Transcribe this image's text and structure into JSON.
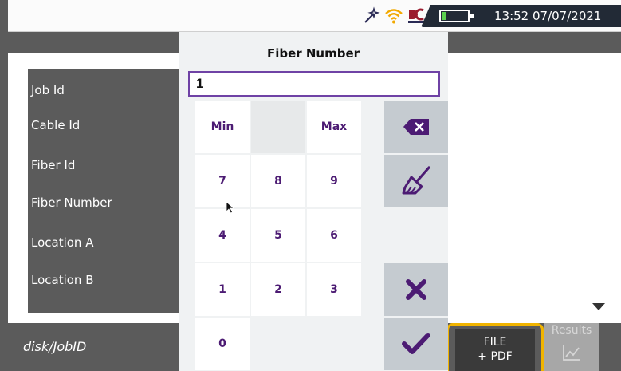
{
  "status_bar": {
    "icons": [
      "magic-wand-icon",
      "wifi-icon",
      "dc-power-icon",
      "battery-icon"
    ],
    "battery_level": 0.2,
    "clock": "13:52 07/07/2021"
  },
  "form": {
    "fields": [
      {
        "label": "Job Id"
      },
      {
        "label": "Cable Id"
      },
      {
        "label": "Fiber Id"
      },
      {
        "label": "Fiber Number"
      },
      {
        "label": "Location A"
      },
      {
        "label": "Location B"
      }
    ]
  },
  "dialog": {
    "title": "Fiber Number",
    "input_value": "1",
    "keys": {
      "min": "Min",
      "max": "Max",
      "k7": "7",
      "k8": "8",
      "k9": "9",
      "k4": "4",
      "k5": "5",
      "k6": "6",
      "k1": "1",
      "k2": "2",
      "k3": "3",
      "k0": "0"
    },
    "actions": [
      "backspace-icon",
      "clear-broom-icon",
      "cancel-x-icon",
      "confirm-check-icon"
    ]
  },
  "bottom_bar": {
    "path": "disk/JobID",
    "file_pdf_line1": "FILE",
    "file_pdf_line2": "+ PDF",
    "results_label": "Results"
  },
  "colors": {
    "accent_purple": "#4c1b73",
    "input_border": "#6f42a5",
    "highlight_orange": "#f1b400",
    "panel_gray": "#5b5b5b",
    "battery_green": "#5bd14f",
    "status_dark": "#222a36"
  }
}
